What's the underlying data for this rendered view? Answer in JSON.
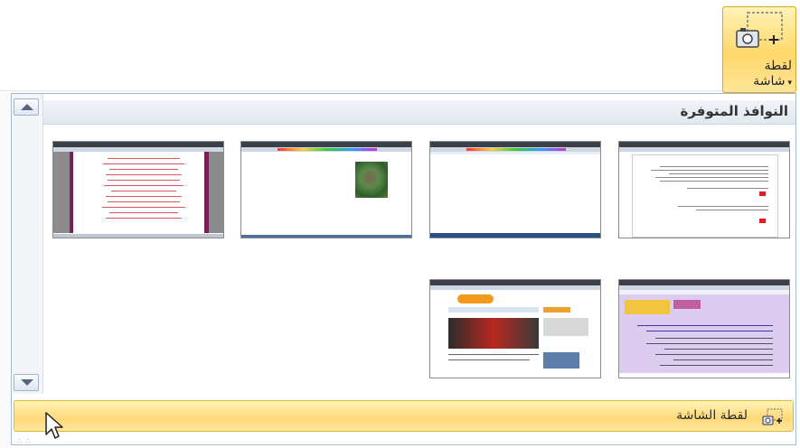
{
  "ribbon": {
    "screenshot_button": {
      "label_line1": "لقطة",
      "label_line2": "شاشة",
      "dropdown_arrow": "▾",
      "icon": "screenshot-camera-icon"
    }
  },
  "gallery": {
    "header": "النوافذ المتوفرة",
    "windows": [
      {
        "name": "window-thumbnail-word-document"
      },
      {
        "name": "window-thumbnail-paint-blank"
      },
      {
        "name": "window-thumbnail-paint-image"
      },
      {
        "name": "window-thumbnail-web-page-poem"
      },
      {
        "name": "window-thumbnail-forum-page"
      },
      {
        "name": "window-thumbnail-news-site"
      }
    ],
    "scroll_up_icon": "arrow-up-icon",
    "scroll_down_icon": "arrow-down-icon"
  },
  "screen_clipping": {
    "label": "لقطة الشاشة",
    "icon": "screen-clipping-icon"
  },
  "colors": {
    "accent_hover": "#ffd978",
    "header_bg": "#e2e8f0",
    "border": "#a9b9cf"
  }
}
